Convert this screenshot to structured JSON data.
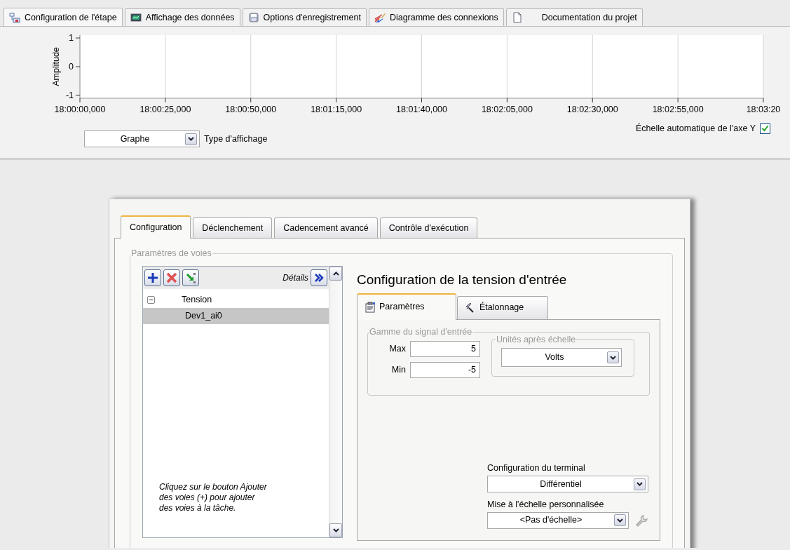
{
  "top_tabs": [
    {
      "label": "Configuration de l'étape",
      "selected": true,
      "kind": "steps"
    },
    {
      "label": "Affichage des données",
      "selected": false,
      "kind": "display"
    },
    {
      "label": "Options d'enregistrement",
      "selected": false,
      "kind": "logging"
    },
    {
      "label": "Diagramme des connexions",
      "selected": false,
      "kind": "wiring"
    },
    {
      "label": "Documentation du projet",
      "selected": false,
      "kind": "document"
    }
  ],
  "chart": {
    "chart_data": {
      "type": "line",
      "ylabel": "Amplitude",
      "ylim": [
        -1.1,
        1.1
      ],
      "grid": true,
      "yticks": [
        1,
        0,
        -1
      ],
      "categories": [
        "18:00:00,000",
        "18:00:25,000",
        "18:00:50,000",
        "18:01:15,000",
        "18:01:40,000",
        "18:02:05,000",
        "18:02:30,000",
        "18:02:55,000",
        "18:03:20"
      ]
    }
  },
  "display_type": {
    "value": "Graphe",
    "label": "Type d'affichage"
  },
  "auto_scale": {
    "label": "Échelle automatique de l'axe Y",
    "checked": true
  },
  "dialog": {
    "tabs": [
      {
        "label": "Configuration",
        "selected": true
      },
      {
        "label": "Déclenchement",
        "selected": false
      },
      {
        "label": "Cadencement avancé",
        "selected": false
      },
      {
        "label": "Contrôle d'exécution",
        "selected": false
      }
    ],
    "channel_group": {
      "title": "Paramètres de voies",
      "details_label": "Détails",
      "tree": [
        {
          "label": "Tension",
          "expanded": true,
          "selected": false,
          "children": [
            {
              "label": "Dev1_ai0",
              "selected": true
            }
          ]
        }
      ],
      "hint_lines": [
        "Cliquez sur le bouton Ajouter",
        "des voies (+) pour ajouter",
        "des voies à la tâche."
      ]
    },
    "panel_title": "Configuration de la tension d'entrée",
    "sub_tabs": [
      {
        "label": "Paramètres",
        "selected": true,
        "kind": "settings"
      },
      {
        "label": "Étalonnage",
        "selected": false,
        "kind": "calibration"
      }
    ],
    "range_group": {
      "title": "Gamme du signal d'entrée",
      "max_label": "Max",
      "max_value": "5",
      "min_label": "Min",
      "min_value": "-5"
    },
    "units_group": {
      "title": "Unités après échelle",
      "value": "Volts"
    },
    "terminal": {
      "label": "Configuration du terminal",
      "value": "Différentiel"
    },
    "custom_scale": {
      "label": "Mise à l'échelle personnalisée",
      "value": "<Pas d'échelle>"
    }
  }
}
